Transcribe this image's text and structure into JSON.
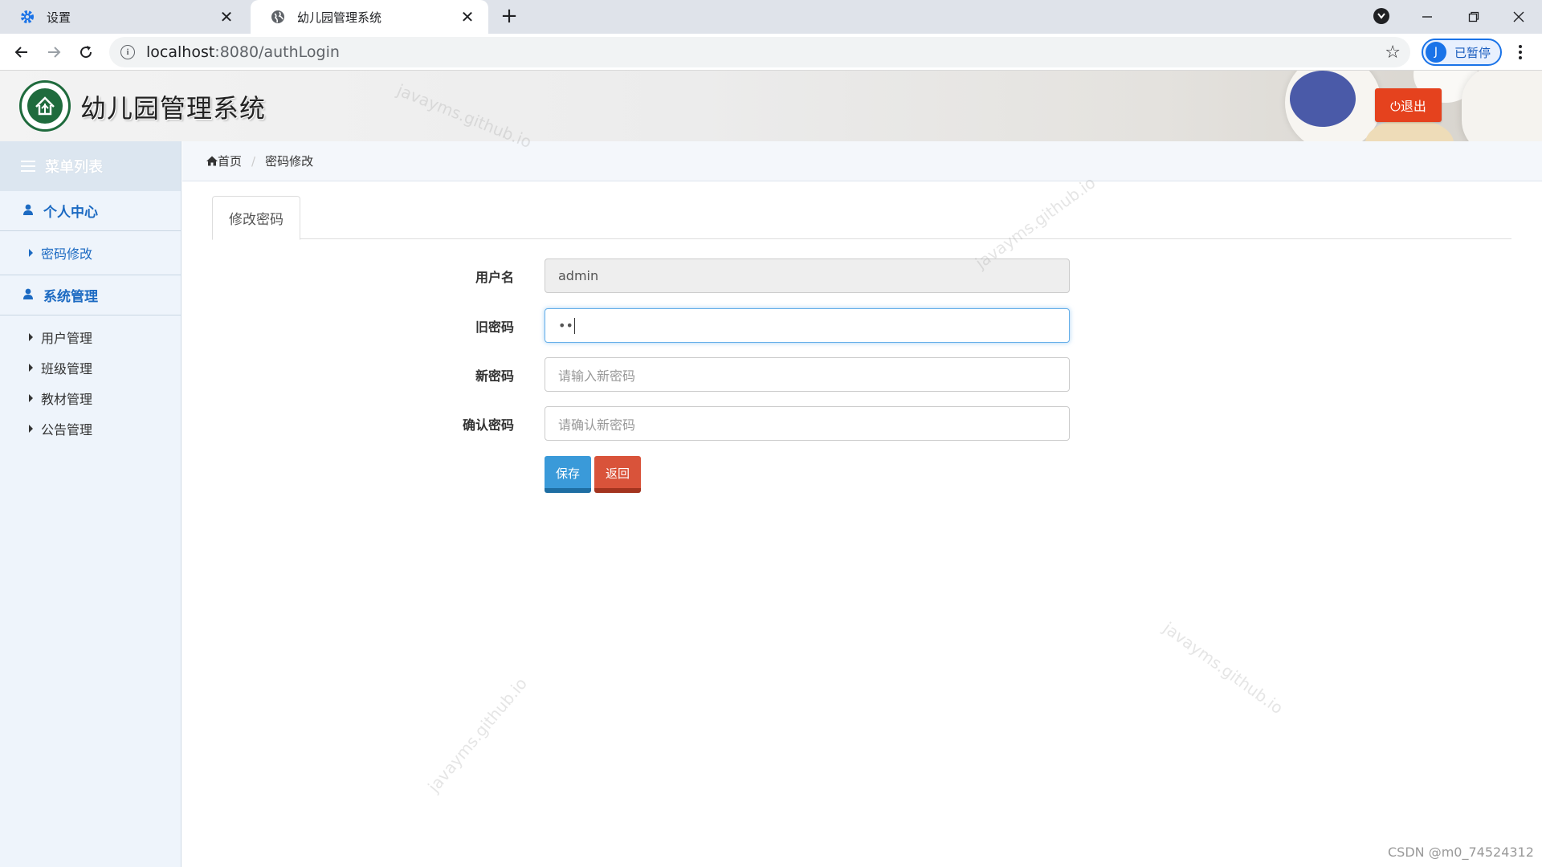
{
  "browser": {
    "tabs": [
      {
        "label": "设置",
        "icon": "gear-icon",
        "active": false
      },
      {
        "label": "幼儿园管理系统",
        "icon": "globe-icon",
        "active": true
      }
    ],
    "new_tab_label": "+",
    "address": {
      "host": "localhost",
      "path": ":8080/authLogin"
    },
    "profile": {
      "initial": "J",
      "label": "已暂停"
    }
  },
  "app": {
    "title": "幼儿园管理系统",
    "logout_label": "⏻退出"
  },
  "sidebar": {
    "menu_title": "菜单列表",
    "groups": [
      {
        "label": "个人中心",
        "items": [
          {
            "label": "密码修改",
            "active": true
          }
        ]
      },
      {
        "label": "系统管理",
        "items": [
          {
            "label": "用户管理",
            "active": false
          },
          {
            "label": "班级管理",
            "active": false
          },
          {
            "label": "教材管理",
            "active": false
          },
          {
            "label": "公告管理",
            "active": false
          }
        ]
      }
    ]
  },
  "breadcrumb": {
    "home": "首页",
    "separator": "/",
    "current": "密码修改"
  },
  "form": {
    "tab_label": "修改密码",
    "username": {
      "label": "用户名",
      "value": "admin"
    },
    "old_password": {
      "label": "旧密码",
      "value": "••"
    },
    "new_password": {
      "label": "新密码",
      "placeholder": "请输入新密码"
    },
    "confirm_password": {
      "label": "确认密码",
      "placeholder": "请确认新密码"
    },
    "save_label": "保存",
    "back_label": "返回"
  },
  "watermark": "javayms.github.io",
  "footer_credit": "CSDN @m0_74524312",
  "colors": {
    "accent": "#1c6ac2",
    "logout": "#e5421e",
    "save": "#3a9ad9",
    "back": "#d9533a"
  }
}
